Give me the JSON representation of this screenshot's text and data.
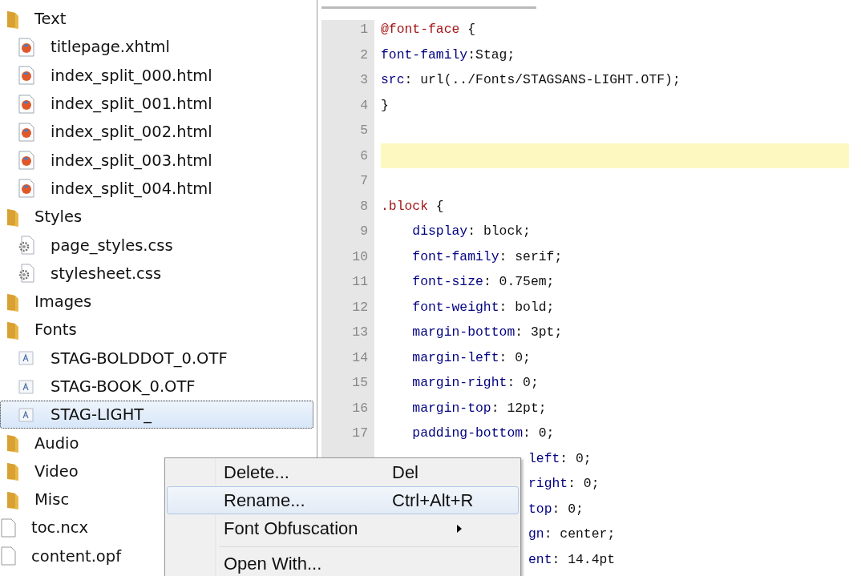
{
  "tree": [
    {
      "label": "Text",
      "kind": "folder",
      "children": [
        {
          "label": "titlepage.xhtml",
          "kind": "html",
          "selected": false
        },
        {
          "label": "index_split_000.html",
          "kind": "html",
          "selected": false
        },
        {
          "label": "index_split_001.html",
          "kind": "html",
          "selected": false
        },
        {
          "label": "index_split_002.html",
          "kind": "html",
          "selected": false
        },
        {
          "label": "index_split_003.html",
          "kind": "html",
          "selected": false
        },
        {
          "label": "index_split_004.html",
          "kind": "html",
          "selected": false
        }
      ]
    },
    {
      "label": "Styles",
      "kind": "folder",
      "children": [
        {
          "label": "page_styles.css",
          "kind": "css",
          "selected": false
        },
        {
          "label": "stylesheet.css",
          "kind": "css",
          "selected": false
        }
      ]
    },
    {
      "label": "Images",
      "kind": "folder"
    },
    {
      "label": "Fonts",
      "kind": "folder",
      "children": [
        {
          "label": "STAG-BOLDDOT_0.OTF",
          "kind": "font",
          "selected": false
        },
        {
          "label": "STAG-BOOK_0.OTF",
          "kind": "font",
          "selected": false
        },
        {
          "label": "STAG-LIGHT_",
          "kind": "font",
          "selected": true
        }
      ]
    },
    {
      "label": "Audio",
      "kind": "folder"
    },
    {
      "label": "Video",
      "kind": "folder"
    },
    {
      "label": "Misc",
      "kind": "folder"
    },
    {
      "label": "toc.ncx",
      "kind": "file",
      "selected": false
    },
    {
      "label": "content.opf",
      "kind": "file",
      "selected": false
    }
  ],
  "editor": {
    "lines": [
      {
        "number": "1",
        "current": false,
        "tokens": [
          {
            "kind": "selector",
            "text": "@font-face"
          },
          {
            "kind": "value",
            "text": " {"
          }
        ]
      },
      {
        "number": "2",
        "current": false,
        "tokens": [
          {
            "kind": "property",
            "text": "font-family"
          },
          {
            "kind": "value",
            "text": ":Stag;"
          }
        ]
      },
      {
        "number": "3",
        "current": false,
        "tokens": [
          {
            "kind": "property",
            "text": "src"
          },
          {
            "kind": "value",
            "text": ": url(../Fonts/STAGSANS-LIGHT.OTF);"
          }
        ]
      },
      {
        "number": "4",
        "current": false,
        "tokens": [
          {
            "kind": "value",
            "text": "}"
          }
        ]
      },
      {
        "number": "5",
        "current": false
      },
      {
        "number": "6",
        "current": true
      },
      {
        "number": "7",
        "current": false
      },
      {
        "number": "8",
        "current": false,
        "tokens": [
          {
            "kind": "selector",
            "text": ".block"
          },
          {
            "kind": "value",
            "text": " {"
          }
        ]
      },
      {
        "number": "9",
        "current": false,
        "tokens": [
          {
            "kind": "property",
            "text": "    display"
          },
          {
            "kind": "value",
            "text": ": block;"
          }
        ]
      },
      {
        "number": "10",
        "current": false,
        "tokens": [
          {
            "kind": "property",
            "text": "    font-family"
          },
          {
            "kind": "value",
            "text": ": serif;"
          }
        ]
      },
      {
        "number": "11",
        "current": false,
        "tokens": [
          {
            "kind": "property",
            "text": "    font-size"
          },
          {
            "kind": "value",
            "text": ": 0.75em;"
          }
        ]
      },
      {
        "number": "12",
        "current": false,
        "tokens": [
          {
            "kind": "property",
            "text": "    font-weight"
          },
          {
            "kind": "value",
            "text": ": bold;"
          }
        ]
      },
      {
        "number": "13",
        "current": false,
        "tokens": [
          {
            "kind": "property",
            "text": "    margin-bottom"
          },
          {
            "kind": "value",
            "text": ": 3pt;"
          }
        ]
      },
      {
        "number": "14",
        "current": false,
        "tokens": [
          {
            "kind": "property",
            "text": "    margin-left"
          },
          {
            "kind": "value",
            "text": ": 0;"
          }
        ]
      },
      {
        "number": "15",
        "current": false,
        "tokens": [
          {
            "kind": "property",
            "text": "    margin-right"
          },
          {
            "kind": "value",
            "text": ": 0;"
          }
        ]
      },
      {
        "number": "16",
        "current": false,
        "tokens": [
          {
            "kind": "property",
            "text": "    margin-top"
          },
          {
            "kind": "value",
            "text": ": 12pt;"
          }
        ]
      },
      {
        "number": "17",
        "current": false,
        "tokens": [
          {
            "kind": "property",
            "text": "    padding-bottom"
          },
          {
            "kind": "value",
            "text": ": 0;"
          }
        ]
      }
    ],
    "hidden_lines": [
      {
        "tokens": [
          {
            "kind": "property",
            "text": "left"
          },
          {
            "kind": "value",
            "text": ": 0;"
          }
        ]
      },
      {
        "tokens": [
          {
            "kind": "property",
            "text": "right"
          },
          {
            "kind": "value",
            "text": ": 0;"
          }
        ]
      },
      {
        "tokens": [
          {
            "kind": "property",
            "text": "top"
          },
          {
            "kind": "value",
            "text": ": 0;"
          }
        ]
      },
      {
        "tokens": [
          {
            "kind": "property",
            "text": "gn"
          },
          {
            "kind": "value",
            "text": ": center;"
          }
        ]
      },
      {
        "tokens": [
          {
            "kind": "property",
            "text": "ent"
          },
          {
            "kind": "value",
            "text": ": 14.4pt"
          }
        ]
      }
    ]
  },
  "context_menu": [
    {
      "label": "Delete...",
      "shortcut": "Del",
      "selected": false,
      "submenu": false
    },
    {
      "label": "Rename...",
      "shortcut": "Ctrl+Alt+R",
      "selected": true,
      "submenu": false
    },
    {
      "label": "Font Obfuscation",
      "selected": false,
      "submenu": true,
      "separator_after": true
    },
    {
      "label": "Open With...",
      "selected": false,
      "submenu": false
    }
  ]
}
